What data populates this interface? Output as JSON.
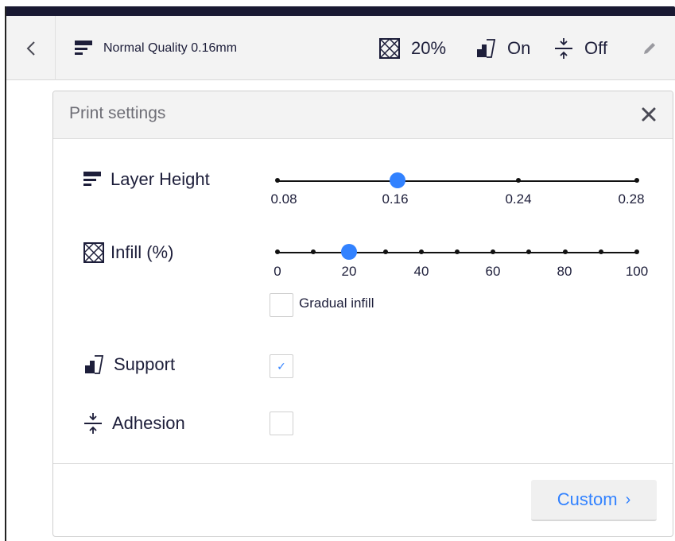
{
  "header": {
    "quality": "Normal Quality 0.16mm",
    "infill": "20%",
    "support": "On",
    "adhesion": "Off"
  },
  "panel": {
    "title": "Print settings",
    "layer_height": {
      "label": "Layer Height",
      "ticks": [
        "0.08",
        "0.16",
        "0.24",
        "0.28"
      ],
      "value": "0.16"
    },
    "infill": {
      "label": "Infill (%)",
      "ticks": [
        "0",
        "20",
        "40",
        "60",
        "80",
        "100"
      ],
      "value": 20,
      "gradual_label": "Gradual infill",
      "gradual_checked": false
    },
    "support": {
      "label": "Support",
      "checked": true
    },
    "adhesion": {
      "label": "Adhesion",
      "checked": false
    },
    "custom_label": "Custom"
  },
  "colors": {
    "accent": "#3282ff",
    "dark": "#191932",
    "text": "#1d1e3a",
    "muted": "#6e6e76"
  }
}
